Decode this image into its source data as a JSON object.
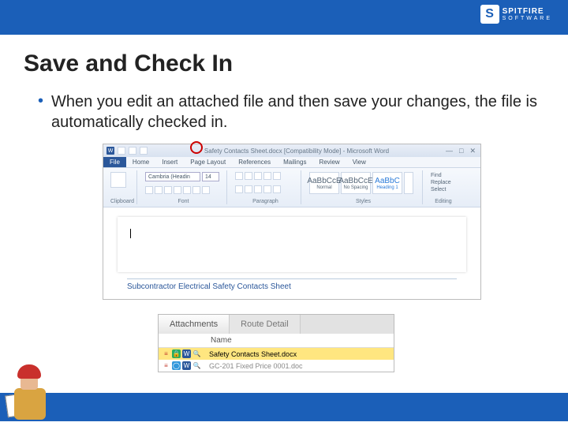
{
  "header": {
    "brand_top": "SPITFIRE",
    "brand_sub": "SOFTWARE",
    "brand_mark": "S"
  },
  "slide": {
    "title": "Save and Check In",
    "bullet": "When you edit an attached file and then save your changes, the file is automatically checked in."
  },
  "word": {
    "title": "Safety Contacts Sheet.docx [Compatibility Mode] - Microsoft Word",
    "tabs": {
      "file": "File",
      "home": "Home",
      "insert": "Insert",
      "pagelayout": "Page Layout",
      "references": "References",
      "mailings": "Mailings",
      "review": "Review",
      "view": "View"
    },
    "font_name": "Cambria (Headin",
    "font_size": "14",
    "ribbon": {
      "clipboard": "Clipboard",
      "font": "Font",
      "paragraph": "Paragraph",
      "styles": "Styles",
      "editing": "Editing"
    },
    "styles": {
      "s1": "Normal",
      "s2": "No Spacing",
      "s3": "Heading 1",
      "more": "More"
    },
    "editing_items": {
      "find": "Find",
      "replace": "Replace",
      "select": "Select"
    },
    "doc_heading": "Subcontractor Electrical Safety Contacts Sheet"
  },
  "attach": {
    "tab1": "Attachments",
    "tab2": "Route Detail",
    "col_name": "Name",
    "row1": "Safety Contacts Sheet.docx",
    "row2": "GC-201 Fixed Price 0001.doc"
  }
}
